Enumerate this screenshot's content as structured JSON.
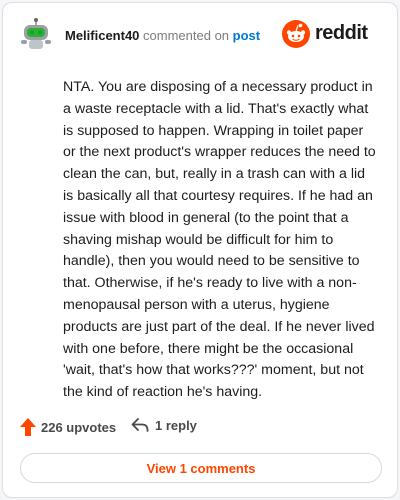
{
  "comment": {
    "username": "Melificent40",
    "action_text": "commented on",
    "post_link": "post",
    "body": "NTA. You are disposing of a necessary product in a waste receptacle with a lid. That's exactly what is supposed to happen. Wrapping in toilet paper or the next product's wrapper reduces the need to clean the can, but, really in a trash can with a lid is basically all that courtesy requires. If he had an issue with blood in general (to the point that a shaving mishap would be difficult for him to handle), then you would need to be sensitive to that. Otherwise, if he's ready to live with a non-menopausal person with a uterus, hygiene products are just part of the deal. If he never lived with one before, there might be the occasional 'wait, that's how that works???' moment, but not the kind of reaction he's having."
  },
  "brand": {
    "wordmark": "reddit",
    "color": "#ff4500"
  },
  "footer": {
    "upvotes": "226 upvotes",
    "replies": "1 reply",
    "view_comments": "View 1 comments"
  },
  "icons": {
    "avatar": "robot-avatar-icon",
    "logo": "reddit-alien-icon",
    "upvote": "upvote-arrow-icon",
    "reply": "reply-arrow-icon"
  }
}
